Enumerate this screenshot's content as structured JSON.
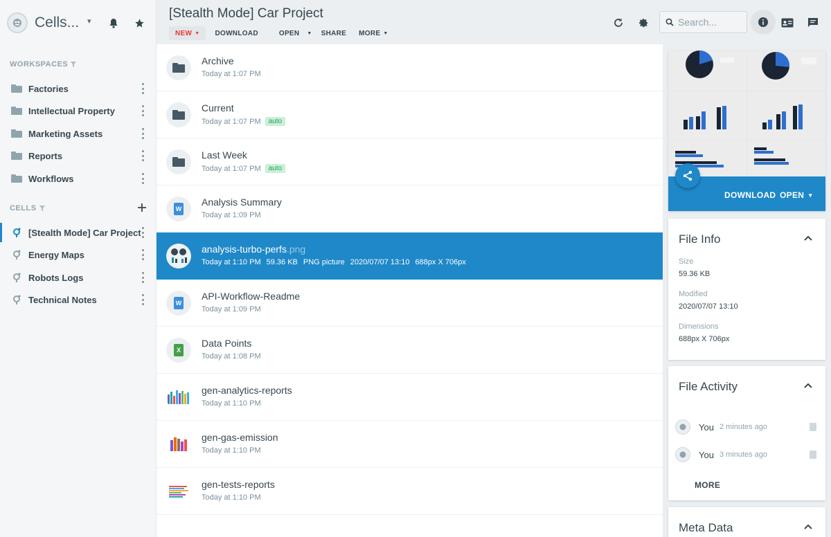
{
  "brand": {
    "title": "Cells...",
    "caret": "▾"
  },
  "sidebar": {
    "workspaces_label": "WORKSPACES",
    "workspaces": [
      {
        "label": "Factories"
      },
      {
        "label": "Intellectual Property"
      },
      {
        "label": "Marketing Assets"
      },
      {
        "label": "Reports"
      },
      {
        "label": "Workflows"
      }
    ],
    "cells_label": "CELLS",
    "cells": [
      {
        "label": "[Stealth Mode] Car Project",
        "active": true
      },
      {
        "label": "Energy Maps"
      },
      {
        "label": "Robots Logs"
      },
      {
        "label": "Technical Notes"
      }
    ]
  },
  "header": {
    "title": "[Stealth Mode] Car Project",
    "toolbar": {
      "new": "NEW",
      "download": "DOWNLOAD",
      "open": "OPEN",
      "share": "SHARE",
      "more": "MORE"
    },
    "search_placeholder": "Search..."
  },
  "files": [
    {
      "name": "Archive",
      "meta": "Today at 1:07 PM",
      "type": "folder"
    },
    {
      "name": "Current",
      "meta": "Today at 1:07 PM",
      "tag": "auto",
      "type": "folder"
    },
    {
      "name": "Last Week",
      "meta": "Today at 1:07 PM",
      "tag": "auto",
      "type": "folder"
    },
    {
      "name": "Analysis Summary",
      "meta": "Today at 1:09 PM",
      "type": "word"
    },
    {
      "name": "analysis-turbo-perfs",
      "ext": ".png",
      "meta": "Today at 1:10 PM",
      "size": "59.36 KB",
      "kind": "PNG picture",
      "date": "2020/07/07 13:10",
      "dims": "688px X 706px",
      "type": "image",
      "selected": true
    },
    {
      "name": "API-Workflow-Readme",
      "meta": "Today at 1:09 PM",
      "type": "word"
    },
    {
      "name": "Data Points",
      "meta": "Today at 1:08 PM",
      "type": "excel"
    },
    {
      "name": "gen-analytics-reports",
      "meta": "Today at 1:10 PM",
      "type": "chart"
    },
    {
      "name": "gen-gas-emission",
      "meta": "Today at 1:10 PM",
      "type": "chart"
    },
    {
      "name": "gen-tests-reports",
      "meta": "Today at 1:10 PM",
      "type": "chart"
    }
  ],
  "preview": {
    "download": "DOWNLOAD",
    "open": "OPEN",
    "caret": "▾"
  },
  "file_info": {
    "title": "File Info",
    "size_label": "Size",
    "size": "59.36 KB",
    "modified_label": "Modified",
    "modified": "2020/07/07 13:10",
    "dims_label": "Dimensions",
    "dims": "688px X 706px"
  },
  "activity": {
    "title": "File Activity",
    "items": [
      {
        "user": "You",
        "time": "2 minutes ago"
      },
      {
        "user": "You",
        "time": "3 minutes ago"
      }
    ],
    "more": "MORE"
  },
  "meta_data": {
    "title": "Meta Data"
  },
  "colors": {
    "accent": "#1e88c8",
    "new": "#e53935",
    "tag_bg": "#c8f1d8",
    "tag_fg": "#2e9b5d"
  }
}
